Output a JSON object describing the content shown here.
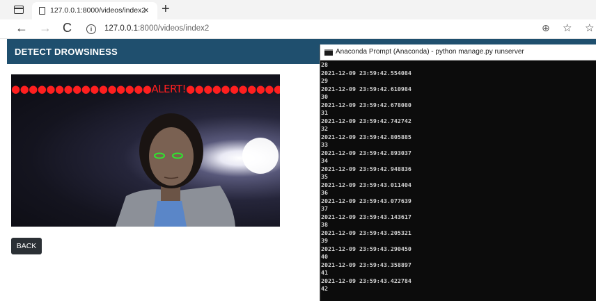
{
  "browser": {
    "tab_title": "127.0.0.1:8000/videos/index2",
    "tab_close": "×",
    "new_tab": "+",
    "url_host": "127.0.0.1",
    "url_path": ":8000/videos/index2",
    "icons": {
      "back": "←",
      "forward": "→",
      "refresh": "C",
      "info": "i",
      "zoom": "⊕",
      "favorites": "☆",
      "collections": "☆"
    }
  },
  "page": {
    "title": "DETECT DROWSINESS",
    "video": {
      "alert_text": "●●●●●●●●●●●●●●●●ALERT!●●●●●●●●●●●●●●●●●"
    },
    "back_label": "BACK"
  },
  "console": {
    "title": "Anaconda Prompt (Anaconda) - python  manage.py runserver",
    "lines": [
      "28",
      "2021-12-09 23:59:42.554084",
      "29",
      "2021-12-09 23:59:42.610984",
      "30",
      "2021-12-09 23:59:42.678080",
      "31",
      "2021-12-09 23:59:42.742742",
      "32",
      "2021-12-09 23:59:42.805885",
      "33",
      "2021-12-09 23:59:42.893037",
      "34",
      "2021-12-09 23:59:42.948836",
      "35",
      "2021-12-09 23:59:43.011404",
      "36",
      "2021-12-09 23:59:43.077639",
      "37",
      "2021-12-09 23:59:43.143617",
      "38",
      "2021-12-09 23:59:43.205321",
      "39",
      "2021-12-09 23:59:43.290450",
      "40",
      "2021-12-09 23:59:43.358897",
      "41",
      "2021-12-09 23:59:43.422784",
      "42"
    ]
  },
  "colors": {
    "header_bg": "#1f4f6e",
    "alert_red": "#ff1f1f",
    "eye_contour": "#2ee82e",
    "console_bg": "#0c0c0c",
    "console_text": "#d4d4d4",
    "button_bg": "#2b3035"
  }
}
